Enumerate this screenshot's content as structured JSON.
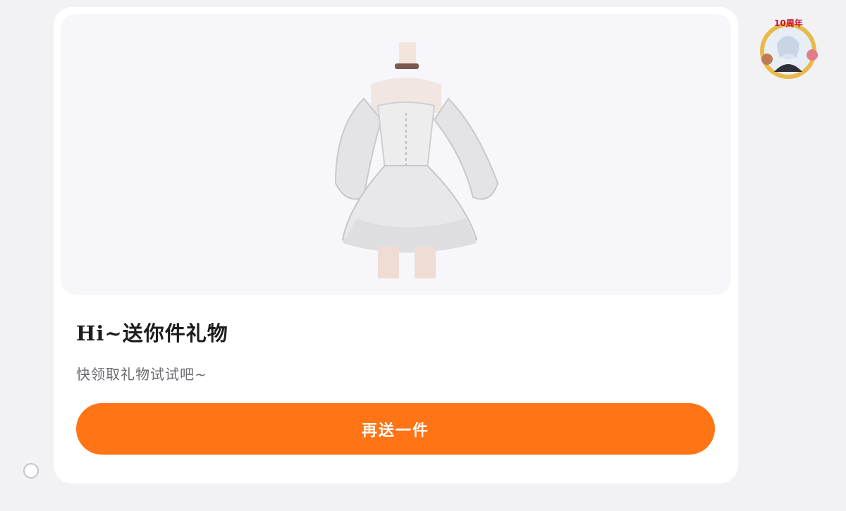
{
  "gift_card": {
    "title": "Hi~送你件礼物",
    "subtitle": "快领取礼物试试吧~",
    "button_label": "再送一件",
    "image": "white-lolita-dress-image"
  },
  "avatar": {
    "badge_text": "10周年",
    "icon": "anniversary-avatar"
  },
  "colors": {
    "accent": "#ff7414",
    "background": "#f2f2f4",
    "card": "#ffffff",
    "image_bg": "#f7f7fb"
  }
}
